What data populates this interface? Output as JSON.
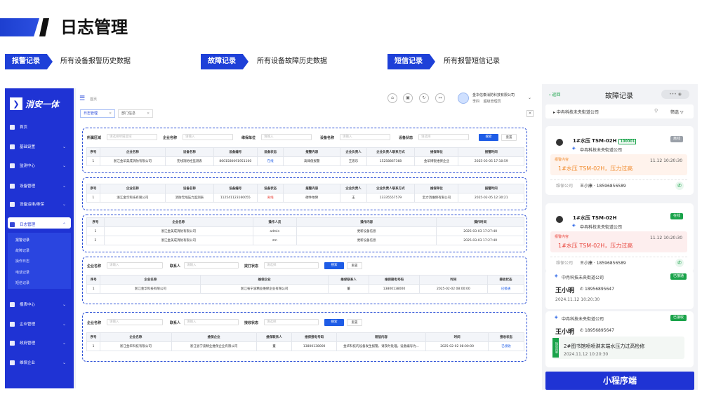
{
  "page": {
    "title": "日志管理"
  },
  "tags": [
    {
      "label": "报警记录",
      "desc": "所有设备报警历史数据"
    },
    {
      "label": "故障记录",
      "desc": "所有设备故障历史数据"
    },
    {
      "label": "短信记录",
      "desc": "所有报警短信记录"
    }
  ],
  "sidebar": {
    "logo": "消安一体",
    "items": [
      "首页",
      "基础设置",
      "监测中心",
      "设备管理",
      "设备运维/维保",
      "日志管理",
      "报表中心",
      "企业管理",
      "政府管理",
      "维保企业"
    ],
    "subitems": [
      "报警记录",
      "故障记录",
      "操作日志",
      "电话记录",
      "短信记录"
    ]
  },
  "header": {
    "crumb": "首页",
    "company": "金华信泰消防科技有限公司",
    "user": "李四",
    "role": "超级管理员"
  },
  "tabs": [
    "日志管理",
    "部门信息"
  ],
  "filters1": {
    "region": "所属区域",
    "region_ph": "请选择所属区域",
    "company": "企业名称",
    "company_ph": "请输入",
    "unit": "维保单位",
    "unit_ph": "请输入",
    "device": "设备名称",
    "device_ph": "请输入",
    "status": "设备状态",
    "status_ph": "请选择",
    "search": "搜索",
    "reset": "重置"
  },
  "t1": {
    "headers": [
      "序号",
      "企业名称",
      "设备名称",
      "设备编号",
      "设备状态",
      "报警内容",
      "企业负责人",
      "企业负责人联系方式",
      "维保单位",
      "报警时间"
    ],
    "rows": [
      [
        "1",
        "浙江金华美成消防有限公司",
        "无线消防栓监测表",
        "8601580091951100",
        "在线",
        "高阈值报警",
        "王思乐",
        "15258867368",
        "金华博锐维保企业",
        "2025-03-05 17:10:59"
      ]
    ]
  },
  "t2": {
    "headers": [
      "序号",
      "企业名称",
      "设备名称",
      "设备编号",
      "设备状态",
      "报警内容",
      "企业负责人",
      "企业负责人联系方式",
      "维保单位",
      "报警时间"
    ],
    "rows": [
      [
        "1",
        "浙江金华科技有限公司",
        "消防无线压力监测表",
        "112541123160055",
        "离线",
        "硬件故障",
        "王",
        "13335557579",
        "至力消维保有限公司",
        "2025-02-05 12:30:21"
      ]
    ]
  },
  "t3": {
    "headers": [
      "序号",
      "企业名称",
      "操作人员",
      "操作内容",
      "操作时间"
    ],
    "rows": [
      [
        "1",
        "浙江金美成消防有限公司",
        "admin",
        "更新设备信息",
        "2025-03-03 17:27:40"
      ],
      [
        "2",
        "浙江金美成消防有限公司",
        "zm",
        "更新设备信息",
        "2025-03-03 17:27:40"
      ]
    ]
  },
  "filters4": {
    "company": "企业名称",
    "company_ph": "请输入",
    "contact": "联系人",
    "contact_ph": "请输入",
    "status": "拨打状态",
    "status_ph": "请选择",
    "search": "搜索",
    "reset": "重置"
  },
  "t4": {
    "headers": [
      "序号",
      "企业名称",
      "维保企业",
      "维保联系人",
      "维保接电号码",
      "时间",
      "接收状态"
    ],
    "rows": [
      [
        "1",
        "浙江金华科技有限公司",
        "浙江省宁波精业维保企业有限公司",
        "董",
        "13800138000",
        "2025-02-02 08:00:00",
        "已接通"
      ]
    ]
  },
  "filters5": {
    "company": "企业名称",
    "company_ph": "请输入",
    "contact": "联系人",
    "contact_ph": "请输入",
    "status": "接收状态",
    "status_ph": "请选择",
    "search": "搜索",
    "reset": "重置"
  },
  "t5": {
    "headers": [
      "序号",
      "企业名称",
      "维保企业",
      "维保联系人",
      "维保接电号码",
      "短信内容",
      "时间",
      "接收状态"
    ],
    "rows": [
      [
        "1",
        "浙江金华科技有限公司",
        "浙江省宁波精业维保企业有限公司",
        "董",
        "13800138000",
        "金华科技的设备发生报警，请及时处理。设备编号为...",
        "2025-02-02 08:00:00",
        "已接收"
      ]
    ]
  },
  "phone": {
    "back": "返回",
    "title": "故障记录",
    "search": "中冉科技未央街道公司",
    "filter": "筛选",
    "cards": [
      {
        "device": "1#水压 TSM-02H",
        "code": "100001",
        "company": "中冉科技未央街道公司",
        "status": "离线",
        "alarm_label": "报警内容",
        "alarm": "1#水压 TSM-02H，压力过高",
        "time": "11.12 10:20:30",
        "owner": "维保公司",
        "contact": "王小康 · 18596856589"
      },
      {
        "device": "1#水压 TSM-02H",
        "code": "",
        "company": "中冉科技未央街道公司",
        "status": "在线",
        "alarm_label": "报警内容",
        "alarm": "1#水压 TSM-02H，压力过高",
        "time": "11.12 10:20:30",
        "owner": "维保公司",
        "contact": "王小康 · 18596856589"
      }
    ],
    "calls": [
      {
        "company": "中冉科技未央街道公司",
        "status": "已接通",
        "name": "王小明",
        "phone": "18956895647",
        "time": "2024.11.12 10:20:30"
      },
      {
        "company": "中冉科技未央街道公司",
        "status": "已接收",
        "name": "王小明",
        "phone": "18956895647",
        "msg_tag": "短信内容",
        "msg": "2#图书馆喷喷淋末端水压力过高检修",
        "time": "2024.11.12 10:20:30"
      }
    ]
  },
  "mini": "小程序端"
}
